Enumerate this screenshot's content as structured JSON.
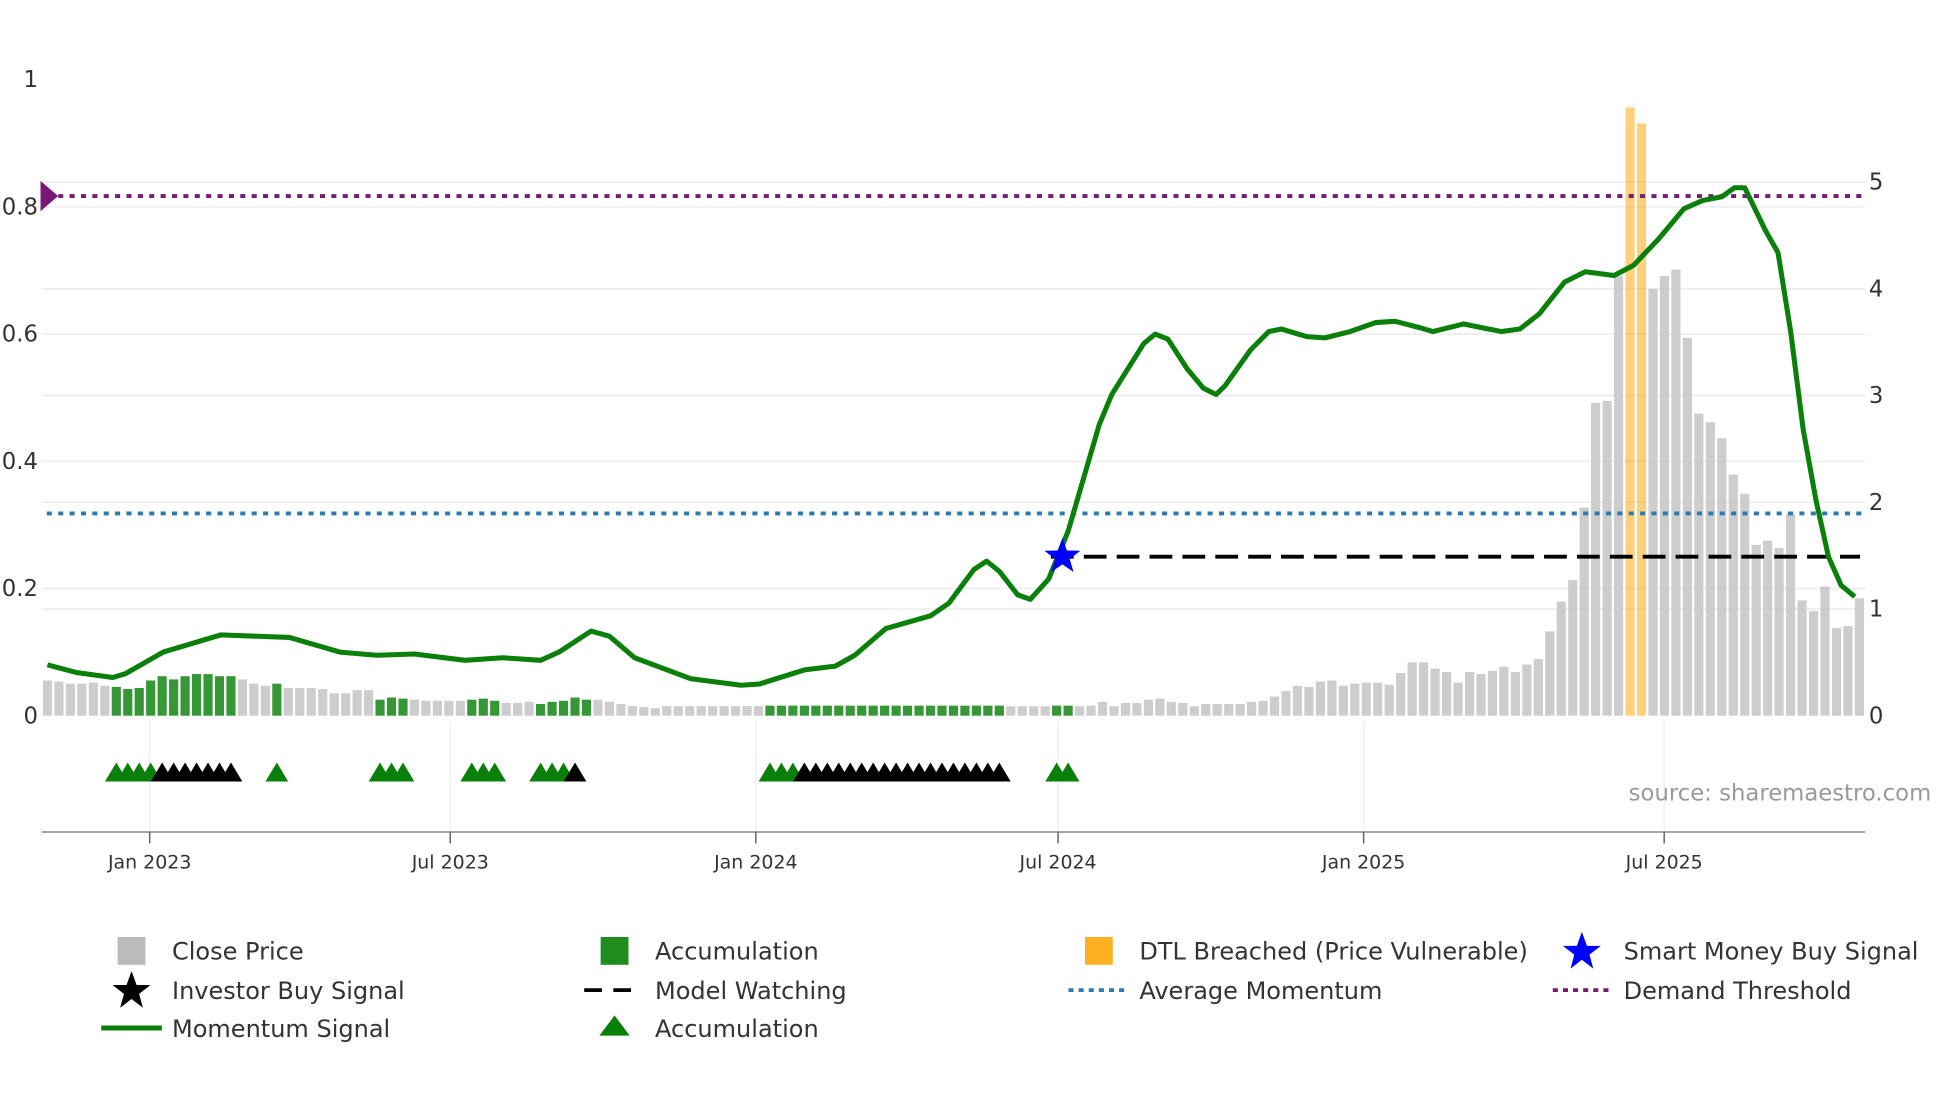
{
  "chart_data": {
    "type": "bar",
    "title": "",
    "source": "source: sharemaestro.com",
    "left_axis": {
      "range": [
        0,
        1
      ],
      "ticks": [
        0,
        0.2,
        0.4,
        0.6,
        0.8,
        1
      ],
      "labels": [
        "0",
        "0.2",
        "0.4",
        "0.6",
        "0.8",
        "1"
      ]
    },
    "right_axis": {
      "range": [
        0,
        5.95
      ],
      "ticks": [
        0,
        1,
        2,
        3,
        4,
        5
      ],
      "labels": [
        "0",
        "1",
        "2",
        "3",
        "4",
        "5"
      ]
    },
    "x_axis": {
      "range": [
        "2022-10-28",
        "2025-10-30"
      ],
      "ticks": [
        {
          "label": "Jan 2023",
          "date": "2023-01-01"
        },
        {
          "label": "Jul 2023",
          "date": "2023-07-01"
        },
        {
          "label": "Jan 2024",
          "date": "2024-01-01"
        },
        {
          "label": "Jul 2024",
          "date": "2024-07-01"
        },
        {
          "label": "Jan 2025",
          "date": "2025-01-01"
        },
        {
          "label": "Jul 2025",
          "date": "2025-07-01"
        }
      ]
    },
    "close_price_weekly": [
      0.33,
      0.32,
      0.3,
      0.3,
      0.31,
      0.28,
      0.27,
      0.25,
      0.26,
      0.33,
      0.37,
      0.34,
      0.37,
      0.39,
      0.39,
      0.37,
      0.37,
      0.34,
      0.3,
      0.28,
      0.3,
      0.26,
      0.26,
      0.26,
      0.25,
      0.21,
      0.21,
      0.24,
      0.24,
      0.15,
      0.17,
      0.16,
      0.15,
      0.14,
      0.14,
      0.14,
      0.14,
      0.15,
      0.16,
      0.14,
      0.12,
      0.12,
      0.13,
      0.11,
      0.13,
      0.14,
      0.17,
      0.15,
      0.15,
      0.13,
      0.11,
      0.09,
      0.08,
      0.07,
      0.09,
      0.09,
      0.09,
      0.09,
      0.09,
      0.09,
      0.09,
      0.09,
      0.09,
      0.094,
      0.094,
      0.094,
      0.094,
      0.094,
      0.094,
      0.094,
      0.094,
      0.094,
      0.094,
      0.094,
      0.094,
      0.094,
      0.094,
      0.094,
      0.094,
      0.094,
      0.094,
      0.094,
      0.094,
      0.094,
      0.088,
      0.088,
      0.088,
      0.088,
      0.094,
      0.094,
      0.088,
      0.094,
      0.13,
      0.088,
      0.12,
      0.12,
      0.15,
      0.16,
      0.13,
      0.12,
      0.088,
      0.11,
      0.11,
      0.11,
      0.11,
      0.13,
      0.14,
      0.18,
      0.23,
      0.28,
      0.27,
      0.32,
      0.33,
      0.28,
      0.3,
      0.31,
      0.31,
      0.29,
      0.4,
      0.5,
      0.5,
      0.44,
      0.41,
      0.31,
      0.41,
      0.39,
      0.42,
      0.46,
      0.41,
      0.48,
      0.53,
      0.79,
      1.07,
      1.27,
      1.95,
      2.93,
      2.95,
      4.12,
      5.7,
      5.55,
      4.0,
      4.12,
      4.18,
      3.54,
      2.83,
      2.75,
      2.6,
      2.26,
      2.08,
      1.6,
      1.64,
      1.57,
      1.89,
      1.08,
      0.98,
      1.21,
      0.82,
      0.84,
      1.1
    ],
    "accumulation_weeks": [
      6,
      7,
      8,
      9,
      10,
      11,
      12,
      13,
      14,
      15,
      16,
      20,
      29,
      30,
      31,
      37,
      38,
      39,
      43,
      44,
      45,
      46,
      47,
      63,
      64,
      65,
      66,
      67,
      68,
      69,
      70,
      71,
      72,
      73,
      74,
      75,
      76,
      77,
      78,
      79,
      80,
      81,
      82,
      83,
      88,
      89
    ],
    "dtl_breached_weeks": [
      138,
      139
    ],
    "markers": {
      "accumulation_triangles": [
        6,
        7,
        8,
        9,
        20,
        29,
        30,
        31,
        37,
        38,
        39,
        43,
        44,
        45,
        63,
        64,
        65,
        88,
        89
      ],
      "black_triangles": [
        10,
        11,
        12,
        13,
        14,
        15,
        16,
        46,
        66,
        67,
        68,
        69,
        70,
        71,
        72,
        73,
        74,
        75,
        76,
        77,
        78,
        79,
        80,
        81,
        82,
        83
      ]
    },
    "momentum_signal": [
      [
        0,
        0.08
      ],
      [
        2.5,
        0.068
      ],
      [
        5.7,
        0.06
      ],
      [
        6.8,
        0.066
      ],
      [
        10.1,
        0.1
      ],
      [
        15.1,
        0.127
      ],
      [
        21.1,
        0.123
      ],
      [
        25.5,
        0.1
      ],
      [
        28.7,
        0.095
      ],
      [
        32,
        0.097
      ],
      [
        36.4,
        0.087
      ],
      [
        39.7,
        0.091
      ],
      [
        43,
        0.087
      ],
      [
        44.6,
        0.1
      ],
      [
        47.4,
        0.133
      ],
      [
        49,
        0.125
      ],
      [
        51.2,
        0.091
      ],
      [
        56.1,
        0.058
      ],
      [
        60.5,
        0.048
      ],
      [
        62.1,
        0.05
      ],
      [
        66,
        0.072
      ],
      [
        68.7,
        0.078
      ],
      [
        70.4,
        0.095
      ],
      [
        73.1,
        0.137
      ],
      [
        77,
        0.157
      ],
      [
        78.6,
        0.177
      ],
      [
        80.8,
        0.23
      ],
      [
        81.9,
        0.243
      ],
      [
        83,
        0.227
      ],
      [
        84.6,
        0.19
      ],
      [
        85.7,
        0.183
      ],
      [
        87.3,
        0.215
      ],
      [
        89,
        0.29
      ],
      [
        91.7,
        0.457
      ],
      [
        92.8,
        0.505
      ],
      [
        95.6,
        0.585
      ],
      [
        96.6,
        0.6
      ],
      [
        97.7,
        0.592
      ],
      [
        99.4,
        0.545
      ],
      [
        100.8,
        0.515
      ],
      [
        101.9,
        0.505
      ],
      [
        102.7,
        0.519
      ],
      [
        104.9,
        0.575
      ],
      [
        106.5,
        0.604
      ],
      [
        107.6,
        0.608
      ],
      [
        109.8,
        0.596
      ],
      [
        111.4,
        0.594
      ],
      [
        113.6,
        0.604
      ],
      [
        115.8,
        0.618
      ],
      [
        117.5,
        0.62
      ],
      [
        119.7,
        0.61
      ],
      [
        120.8,
        0.604
      ],
      [
        123.5,
        0.616
      ],
      [
        125.1,
        0.61
      ],
      [
        126.8,
        0.604
      ],
      [
        128.4,
        0.608
      ],
      [
        130.1,
        0.632
      ],
      [
        132.3,
        0.682
      ],
      [
        134.1,
        0.698
      ],
      [
        136.6,
        0.692
      ],
      [
        138.3,
        0.708
      ],
      [
        140.5,
        0.75
      ],
      [
        142.7,
        0.797
      ],
      [
        144.3,
        0.81
      ],
      [
        146,
        0.816
      ],
      [
        147.1,
        0.83
      ],
      [
        148,
        0.83
      ],
      [
        149.8,
        0.763
      ],
      [
        150.9,
        0.728
      ],
      [
        152,
        0.604
      ],
      [
        153.1,
        0.45
      ],
      [
        154.2,
        0.34
      ],
      [
        155.3,
        0.25
      ],
      [
        156.4,
        0.205
      ],
      [
        157.6,
        0.187
      ]
    ],
    "average_momentum": 0.318,
    "demand_threshold": 0.817,
    "model_watching": {
      "value": 0.25,
      "from_week": 87.5
    },
    "smart_money_buy_signal": {
      "week": 88.5,
      "value": 0.25
    },
    "legend": [
      {
        "label": "Close Price",
        "color": "#bbbbbb"
      },
      {
        "label": "Accumulation",
        "color": "#1f8c1f"
      },
      {
        "label": "DTL Breached (Price Vulnerable)",
        "color": "#ffb020"
      },
      {
        "label": "Smart Money Buy Signal",
        "color": "#0000ff"
      },
      {
        "label": "Investor Buy Signal",
        "color": "#000000"
      },
      {
        "label": "Model Watching",
        "color": "#000000"
      },
      {
        "label": "Average Momentum",
        "color": "#2b7bb0"
      },
      {
        "label": "Demand Threshold",
        "color": "#761a76"
      },
      {
        "label": "Momentum Signal",
        "color": "#0a800a"
      },
      {
        "label": "Accumulation",
        "color": "#0a800a"
      }
    ],
    "legend_placement": "bottom",
    "grid": true
  }
}
